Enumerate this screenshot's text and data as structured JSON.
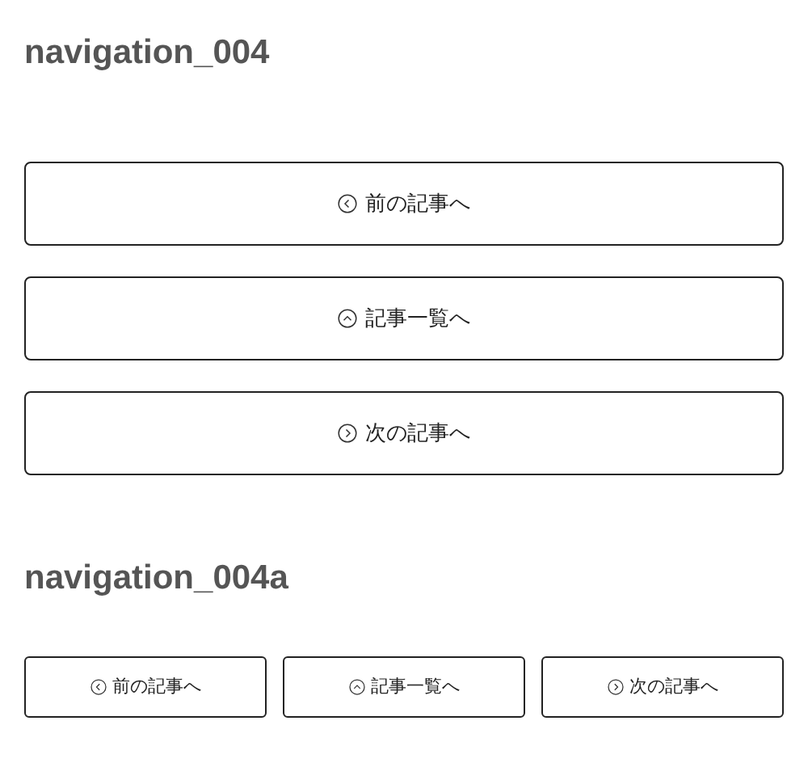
{
  "sections": [
    {
      "title": "navigation_004",
      "kind": "stacked",
      "buttons": [
        {
          "kind": "prev",
          "label": "前の記事へ"
        },
        {
          "kind": "list",
          "label": "記事一覧へ"
        },
        {
          "kind": "next",
          "label": "次の記事へ"
        }
      ]
    },
    {
      "title": "navigation_004a",
      "kind": "row",
      "buttons": [
        {
          "kind": "prev",
          "label": "前の記事へ"
        },
        {
          "kind": "list",
          "label": "記事一覧へ"
        },
        {
          "kind": "next",
          "label": "次の記事へ"
        }
      ]
    }
  ]
}
